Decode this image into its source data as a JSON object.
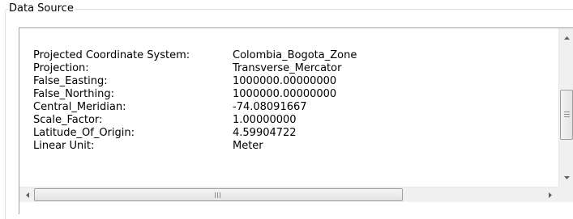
{
  "group": {
    "title": "Data Source"
  },
  "properties": [
    {
      "label": "Projected Coordinate System:",
      "value": "Colombia_Bogota_Zone"
    },
    {
      "label": "Projection:",
      "value": "Transverse_Mercator"
    },
    {
      "label": "False_Easting:",
      "value": "1000000.00000000"
    },
    {
      "label": "False_Northing:",
      "value": "1000000.00000000"
    },
    {
      "label": "Central_Meridian:",
      "value": "-74.08091667"
    },
    {
      "label": "Scale_Factor:",
      "value": "1.00000000"
    },
    {
      "label": "Latitude_Of_Origin:",
      "value": "4.59904722"
    },
    {
      "label": "Linear Unit:",
      "value": "Meter"
    }
  ],
  "scroll": {
    "vertical_position": 0.45,
    "horizontal_position": 0.0
  },
  "icons": {
    "scroll_up": "arrow-up-icon",
    "scroll_down": "arrow-down-icon",
    "scroll_left": "arrow-left-icon",
    "scroll_right": "arrow-right-icon"
  },
  "colors": {
    "group_border": "#d5dfe5",
    "panel_border": "#a0a0a0",
    "scrollbar_track": "#f0f0f0"
  }
}
